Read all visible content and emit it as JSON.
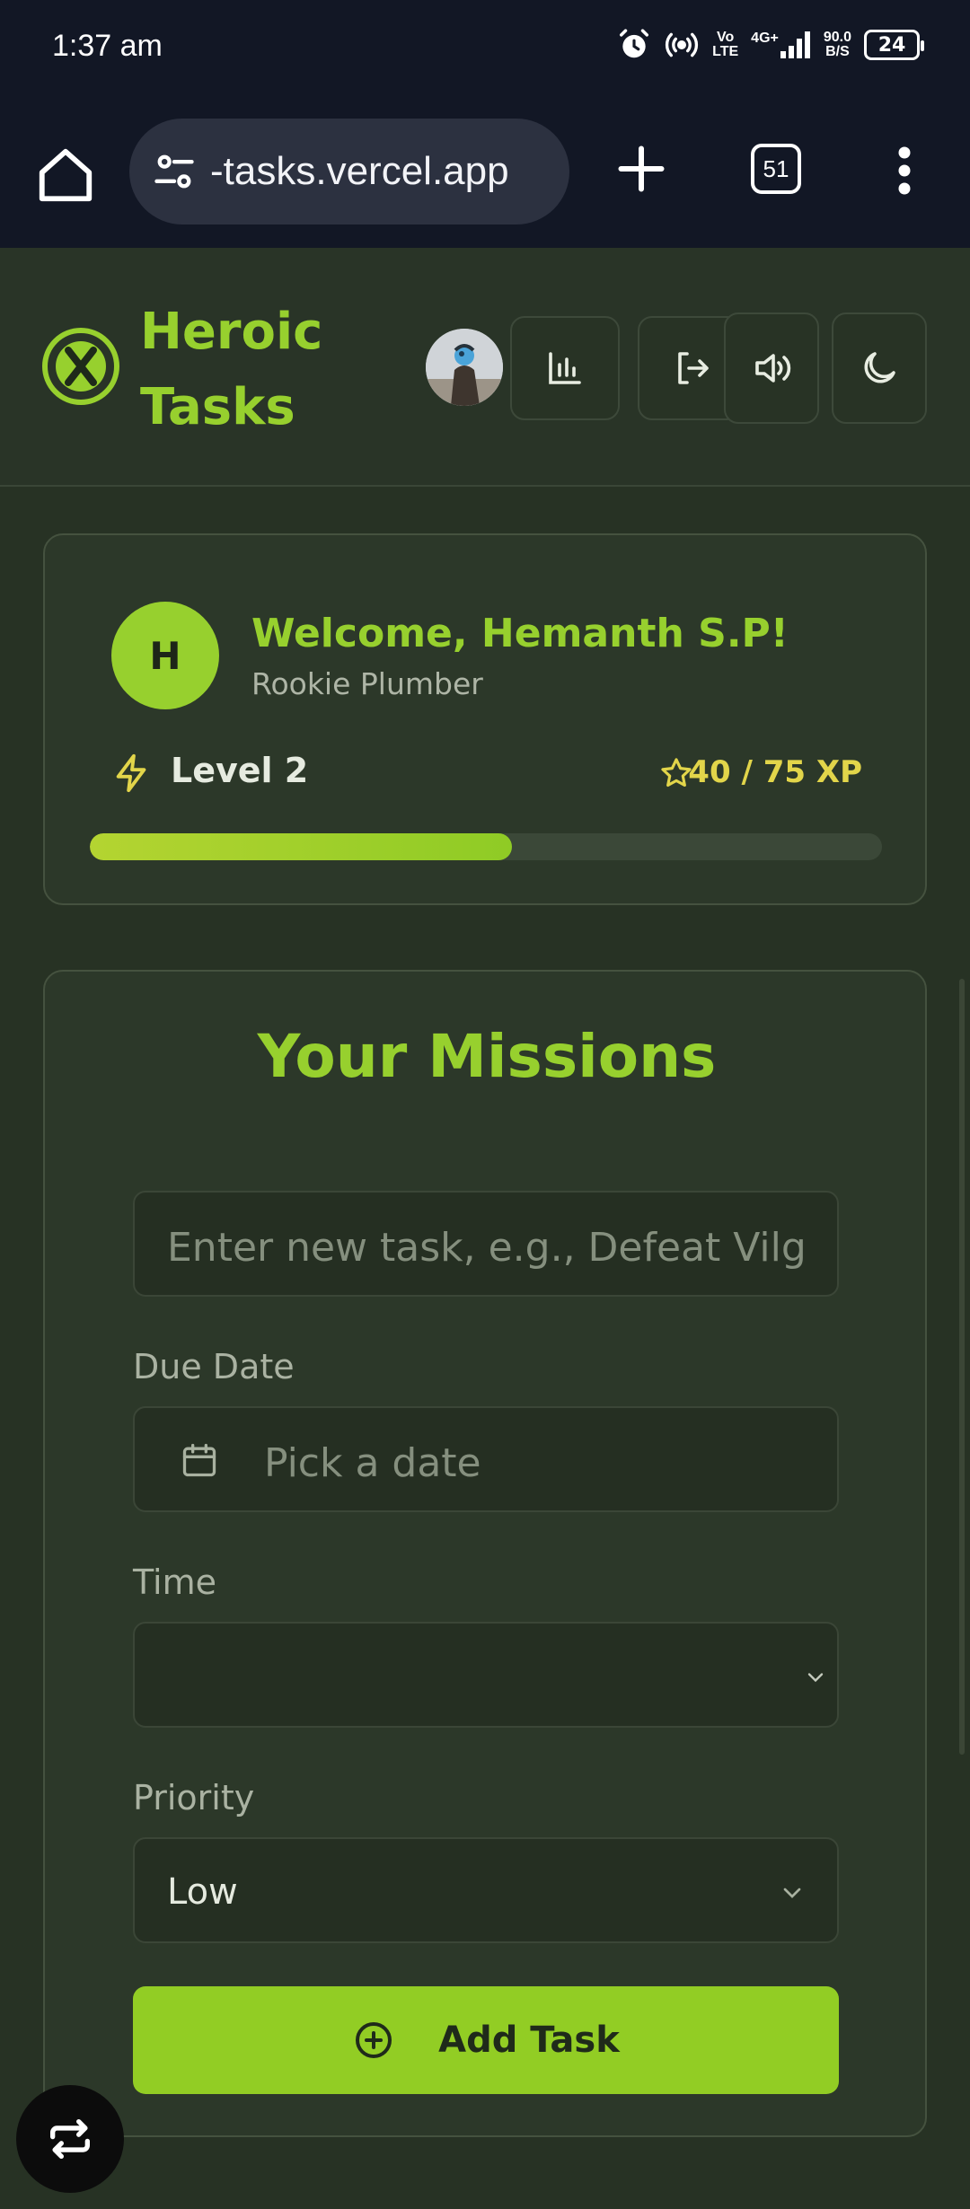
{
  "status_bar": {
    "time": "1:37 am",
    "volte_top": "Vo",
    "volte_bottom": "LTE",
    "network": "4G+",
    "speed_top": "90.0",
    "speed_bottom": "B/S",
    "battery": "24"
  },
  "browser": {
    "url": "-tasks.vercel.app",
    "tab_count": "51"
  },
  "header": {
    "brand_line1": "Heroic",
    "brand_line2": "Tasks"
  },
  "welcome": {
    "avatar_initial": "H",
    "title": "Welcome, Hemanth S.P!",
    "subtitle": "Rookie Plumber",
    "level": "Level 2",
    "xp_text": "40 / 75 XP",
    "xp_current": 40,
    "xp_max": 75
  },
  "missions": {
    "title": "Your Missions",
    "task_placeholder": "Enter new task, e.g., Defeat Vilg",
    "due_date_label": "Due Date",
    "date_placeholder": "Pick a date",
    "time_label": "Time",
    "time_value": "",
    "priority_label": "Priority",
    "priority_value": "Low",
    "add_button": "Add Task"
  },
  "colors": {
    "accent": "#97d02e",
    "xp": "#e2d54a",
    "background": "#273224"
  }
}
